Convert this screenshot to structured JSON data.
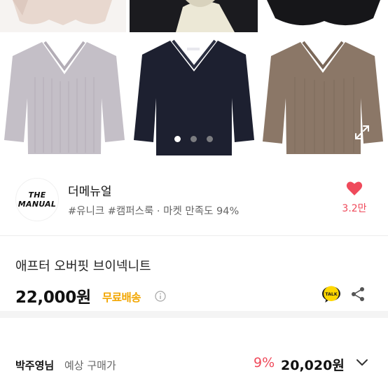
{
  "gallery": {
    "colors": {
      "beige": "#e9d9d0",
      "black": "#1a1a1e",
      "cream": "#ece8d8",
      "gray": "#c3bec6",
      "navy": "#1c1f2e",
      "mocha": "#8a7565"
    },
    "dots": [
      true,
      false,
      false
    ],
    "expand_icon": "expand-icon"
  },
  "shop": {
    "logo_line1": "THE",
    "logo_line2": "MANUAL",
    "name": "더메뉴얼",
    "tags": "#유니크 #캠퍼스룩 · 마켓 만족도 94%",
    "like_count": "3.2만",
    "accent": "#ef4a5b"
  },
  "product": {
    "title": "애프터 오버핏 브이넥니트",
    "price": "22,000원",
    "shipping": "무료배송",
    "talk_label": "TALK"
  },
  "buyer": {
    "name": "박주영님",
    "label": "예상 구매가",
    "discount": "9%",
    "price": "20,020원"
  }
}
